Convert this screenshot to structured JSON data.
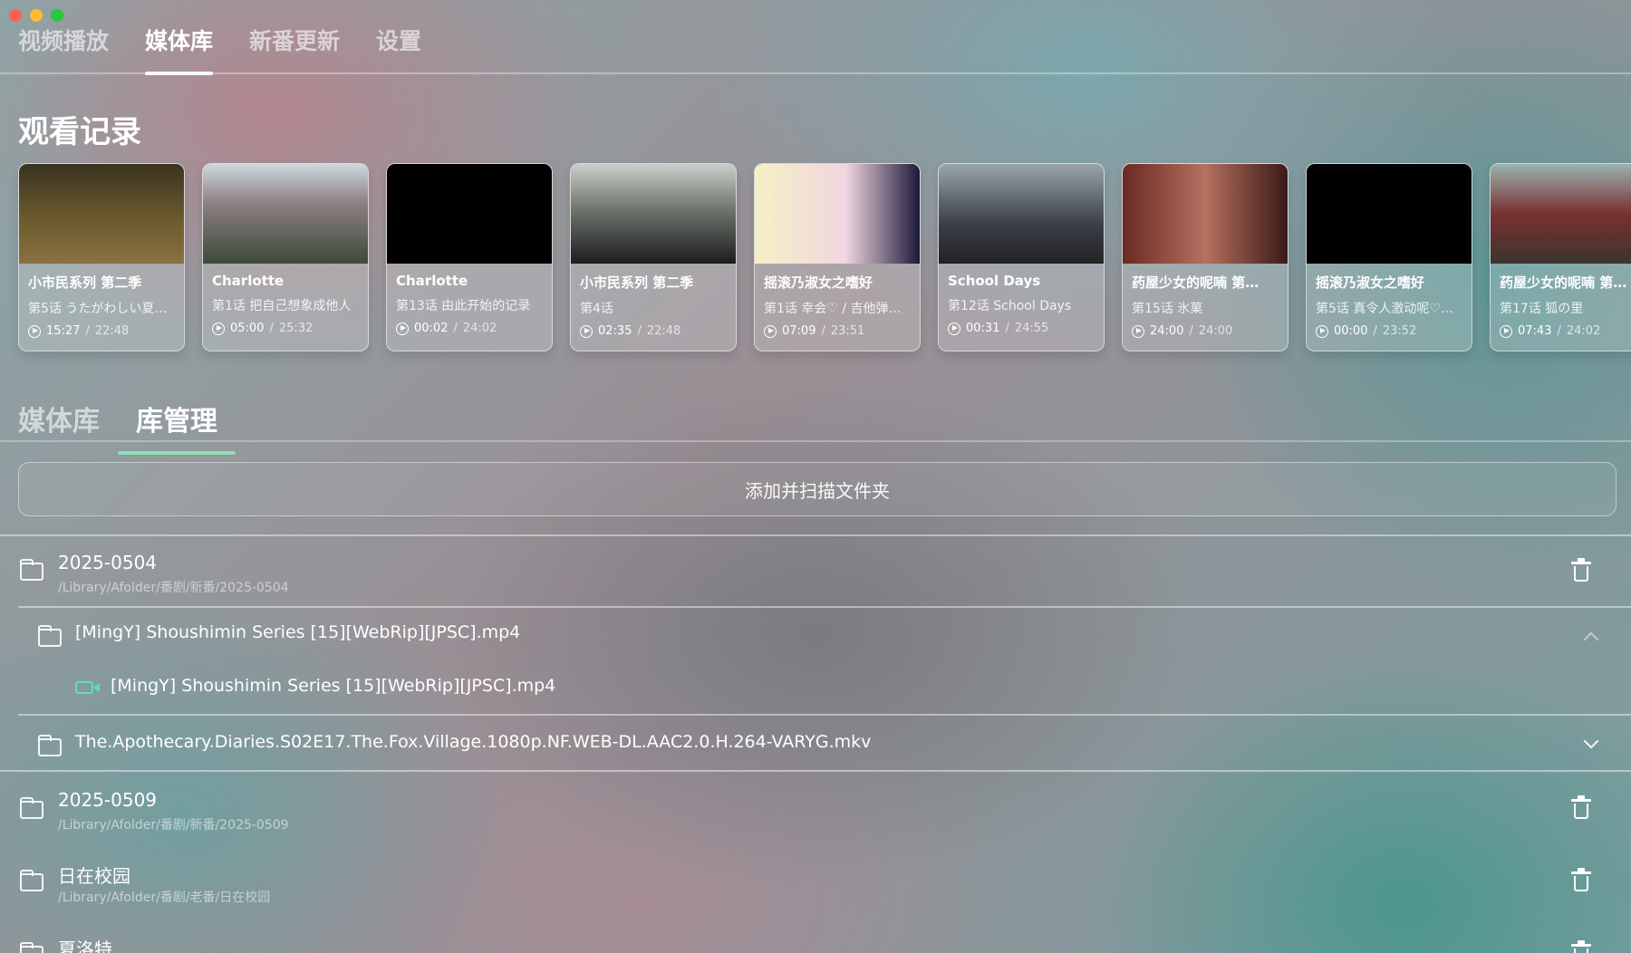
{
  "tabs": [
    {
      "label": "视频播放"
    },
    {
      "label": "媒体库"
    },
    {
      "label": "新番更新"
    },
    {
      "label": "设置"
    }
  ],
  "history_title": "观看记录",
  "history": [
    {
      "title": "小市民系列 第二季",
      "episode": "第5话 うたがわしい夏…",
      "current": "15:27",
      "total": "22:48",
      "thumb": "linear-gradient(180deg,#3a3320 0%,#6b5a2e 55%,#8a7140 100%)"
    },
    {
      "title": "Charlotte",
      "episode": "第1话 把自己想象成他人",
      "current": "05:00",
      "total": "25:32",
      "thumb": "linear-gradient(180deg,#cfd8de 0%,#8c7f80 40%,#3b4a3a 100%)"
    },
    {
      "title": "Charlotte",
      "episode": "第13话 由此开始的记录",
      "current": "00:02",
      "total": "24:02",
      "thumb": "#000000"
    },
    {
      "title": "小市民系列 第二季",
      "episode": "第4话",
      "current": "02:35",
      "total": "22:48",
      "thumb": "linear-gradient(180deg,#c9cfc9 0%,#70766f 45%,#1c1c1c 100%)"
    },
    {
      "title": "摇滚乃淑女之嗜好",
      "episode": "第1话 幸会♡ / 吉他弹…",
      "current": "07:09",
      "total": "23:51",
      "thumb": "linear-gradient(90deg,#f6f0c4 0%,#efd6e0 55%,#1c1a3a 100%)"
    },
    {
      "title": "School Days",
      "episode": "第12话 School Days",
      "current": "00:31",
      "total": "24:55",
      "thumb": "linear-gradient(180deg,#9aa4ab 0%,#3b3f4a 60%,#222 100%)"
    },
    {
      "title": "药屋少女的呢喃 第…",
      "episode": "第15话 氷菓",
      "current": "24:00",
      "total": "24:00",
      "thumb": "linear-gradient(90deg,#6a2a22 0%,#b57060 50%,#3a1a18 100%)"
    },
    {
      "title": "摇滚乃淑女之嗜好",
      "episode": "第5话 真令人激动呢♡…",
      "current": "00:00",
      "total": "23:52",
      "thumb": "#000000"
    },
    {
      "title": "药屋少女的呢喃 第…",
      "episode": "第17话 狐の里",
      "current": "07:43",
      "total": "24:02",
      "thumb": "linear-gradient(180deg,#9bb3b0 0%,#7a3030 50%,#3a3530 100%)"
    }
  ],
  "sub_tabs": [
    {
      "label": "媒体库"
    },
    {
      "label": "库管理"
    }
  ],
  "add_button_label": "添加并扫描文件夹",
  "libraries": [
    {
      "name": "2025-0504",
      "path": "/Library/Afolder/番剧/新番/2025-0504"
    },
    {
      "name": "2025-0509",
      "path": "/Library/Afolder/番剧/新番/2025-0509"
    },
    {
      "name": "日在校园",
      "path": "/Library/Afolder/番剧/老番/日在校园"
    },
    {
      "name": "夏洛特",
      "path": ""
    }
  ],
  "subfolders": [
    {
      "name": "[MingY] Shoushimin Series [15][WebRip][JPSC].mp4"
    },
    {
      "name": "The.Apothecary.Diaries.S02E17.The.Fox.Village.1080p.NF.WEB-DL.AAC2.0.H.264-VARYG.mkv"
    }
  ],
  "files": [
    {
      "name": "[MingY] Shoushimin Series [15][WebRip][JPSC].mp4"
    }
  ]
}
